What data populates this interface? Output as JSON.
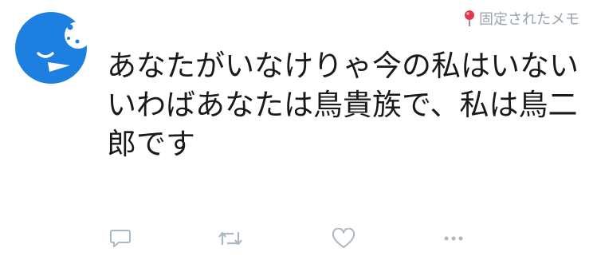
{
  "pinned": {
    "label": "固定されたメモ",
    "icon": "pin-icon"
  },
  "avatar": {
    "icon": "sleeping-bird-avatar",
    "color": "#1d7fe0"
  },
  "tweet": {
    "text": "あなたがいなけりゃ今の私はいない\nいわばあなたは鳥貴族で、私は鳥二郎です"
  },
  "actions": {
    "reply": "reply-icon",
    "retweet": "retweet-icon",
    "like": "heart-icon",
    "more": "more-icon"
  },
  "colors": {
    "icon_gray": "#aab8c2",
    "text": "#1a1a1a",
    "muted": "#9aa3ab"
  }
}
